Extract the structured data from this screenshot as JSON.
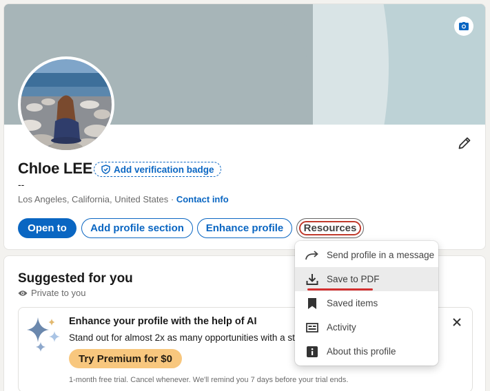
{
  "profile": {
    "name": "Chloe LEE",
    "verification_label": "Add verification badge",
    "headline": "--",
    "location": "Los Angeles, California, United States",
    "location_sep": " · ",
    "contact_label": "Contact info"
  },
  "actions": {
    "open_to": "Open to",
    "add_section": "Add profile section",
    "enhance": "Enhance profile",
    "resources": "Resources"
  },
  "resources_menu": {
    "items": [
      {
        "label": "Send profile in a message",
        "icon": "share-arrow-icon"
      },
      {
        "label": "Save to PDF",
        "icon": "download-icon"
      },
      {
        "label": "Saved items",
        "icon": "bookmark-icon"
      },
      {
        "label": "Activity",
        "icon": "activity-icon"
      },
      {
        "label": "About this profile",
        "icon": "info-icon"
      }
    ]
  },
  "suggested": {
    "title": "Suggested for you",
    "privacy": "Private to you",
    "card": {
      "title": "Enhance your profile with the help of AI",
      "subtitle": "Stand out for almost 2x as many opportunities with a str",
      "cta": "Try Premium for $0",
      "note": "1-month free trial. Cancel whenever. We'll remind you 7 days before your trial ends."
    }
  },
  "colors": {
    "accent": "#0a66c2",
    "premium": "#f8c77e",
    "highlight": "#c0392b"
  }
}
